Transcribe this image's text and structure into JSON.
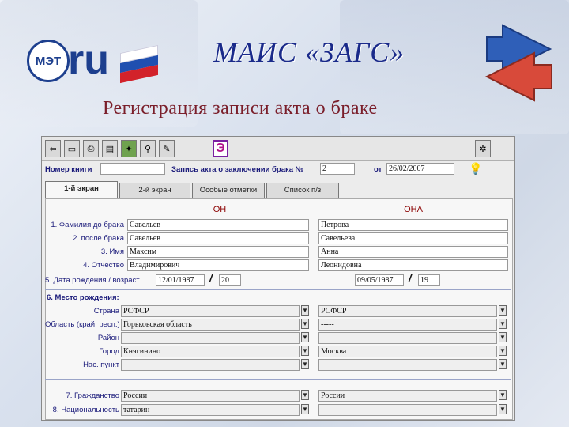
{
  "header": {
    "logo_text": "МЭТ",
    "logo_ru": "ru",
    "app_title": "МАИС «ЗАГС»",
    "subtitle": "Регистрация записи акта о браке"
  },
  "form": {
    "book_label": "Номер книги",
    "book_value": "",
    "record_label": "Запись акта о заключении брака №",
    "record_value": "2",
    "from_label": "от",
    "date_value": "26/02/2007",
    "e_button": "Э",
    "tabs": [
      {
        "label": "1-й экран"
      },
      {
        "label": "2-й экран"
      },
      {
        "label": "Особые отметки"
      },
      {
        "label": "Список п/з"
      }
    ],
    "col_he": "ОН",
    "col_she": "ОНА",
    "labels": {
      "surname_before": "1. Фамилия до брака",
      "surname_after": "2. после брака",
      "name": "3. Имя",
      "patronymic": "4. Отчество",
      "birth": "5. Дата рождения / возраст",
      "place_heading": "6. Место рождения:",
      "country": "Страна",
      "region": "Область (край, респ.)",
      "district": "Район",
      "city": "Город",
      "settlement": "Нас. пункт",
      "citizenship": "7. Гражданство",
      "nationality": "8. Национальность"
    },
    "he": {
      "surname_before": "Савельев",
      "surname_after": "Савельев",
      "name": "Максим",
      "patronymic": "Владимирович",
      "birth_date": "12/01/1987",
      "age": "20",
      "country": "РСФСР",
      "region": "Горьковская область",
      "district": "-----",
      "city": "Княгинино",
      "settlement": "-----",
      "citizenship": "России",
      "nationality": "татарин"
    },
    "she": {
      "surname_before": "Петрова",
      "surname_after": "Савельева",
      "name": "Анна",
      "patronymic": "Леонидовна",
      "birth_date": "09/05/1987",
      "age": "19",
      "country": "РСФСР",
      "region": "-----",
      "district": "-----",
      "city": "Москва",
      "settlement": "-----",
      "citizenship": "России",
      "nationality": "-----"
    },
    "slash": "/",
    "dropdown_glyph": "▼"
  },
  "colors": {
    "title": "#1a2a8a",
    "subtitle": "#7a1e2a",
    "label": "#1a1a7a",
    "column_header": "#8b0000",
    "flag_white": "#ffffff",
    "flag_blue": "#1f4fb0",
    "flag_red": "#d2222a",
    "arrow_blue": "#2f5fb8",
    "arrow_red": "#d84a3a"
  }
}
